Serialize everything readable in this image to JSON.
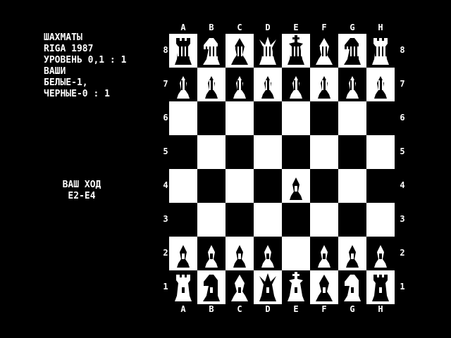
{
  "info": {
    "line1": "ШАХМАТЫ",
    "line2": "RIGA 1987",
    "line3": "УРОВЕНЬ 0,1 : 1",
    "line4": "ВАШИ",
    "line5": "БЕЛЫЕ-1,",
    "line6": "ЧЕРНЫЕ-0 : 1"
  },
  "prompt": {
    "label": "ВАШ ХОД",
    "move": "E2-E4"
  },
  "board": {
    "files": [
      "A",
      "B",
      "C",
      "D",
      "E",
      "F",
      "G",
      "H"
    ],
    "ranks": [
      "8",
      "7",
      "6",
      "5",
      "4",
      "3",
      "2",
      "1"
    ],
    "pieces": [
      [
        "r",
        "n",
        "b",
        "q",
        "k",
        "b",
        "n",
        "r"
      ],
      [
        "p",
        "p",
        "p",
        "p",
        "p",
        "p",
        "p",
        "p"
      ],
      [
        "",
        "",
        "",
        "",
        "",
        "",
        "",
        ""
      ],
      [
        "",
        "",
        "",
        "",
        "",
        "",
        "",
        ""
      ],
      [
        "",
        "",
        "",
        "",
        "P",
        "",
        "",
        ""
      ],
      [
        "",
        "",
        "",
        "",
        "",
        "",
        "",
        ""
      ],
      [
        "P",
        "P",
        "P",
        "P",
        "",
        "P",
        "P",
        "P"
      ],
      [
        "R",
        "N",
        "B",
        "Q",
        "K",
        "B",
        "N",
        "R"
      ]
    ],
    "colors": {
      "light": "#ffffff",
      "dark": "#000000",
      "piece": "#ffffff"
    }
  }
}
